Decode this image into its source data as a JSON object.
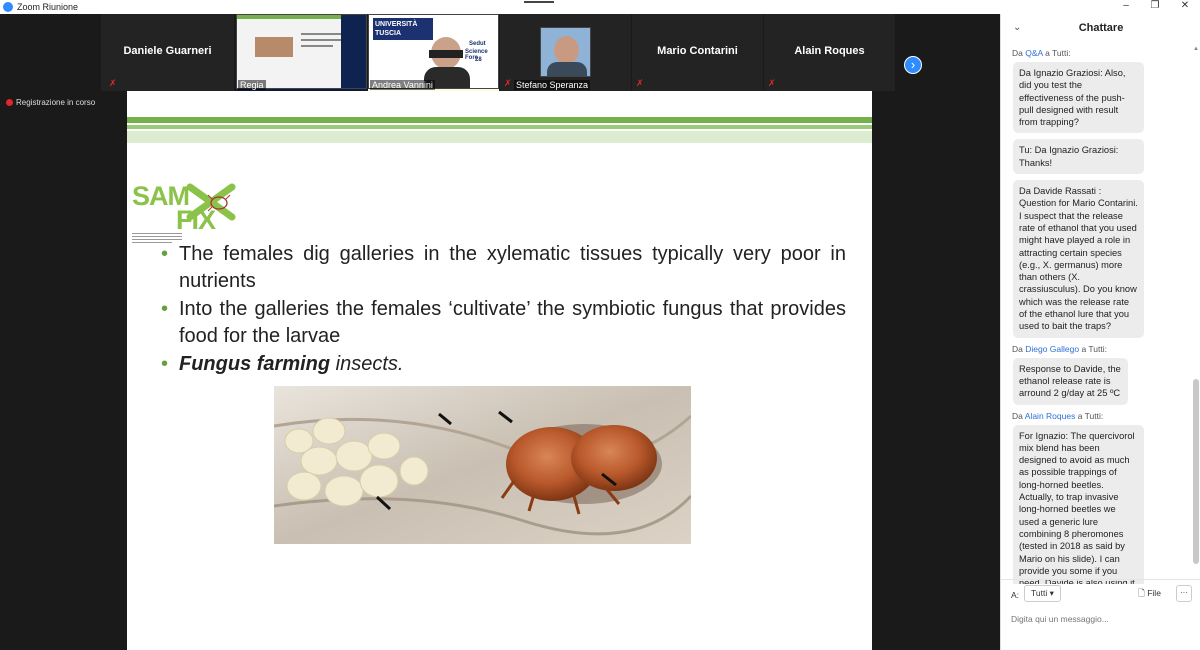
{
  "window": {
    "title": "Zoom Riunione"
  },
  "gallery": {
    "participants": [
      {
        "name": "Daniele Guarneri"
      },
      {
        "name": "Regia"
      },
      {
        "name": "Andrea Vannini"
      },
      {
        "name": "Stefano Speranza"
      },
      {
        "name": "Mario Contarini"
      },
      {
        "name": "Alain Roques"
      }
    ],
    "mini_slide_university": "UNIVERSITÀ TUSCIA",
    "mini_slide_lines": [
      "Sedut",
      "Science Fore",
      "28"
    ]
  },
  "recording": {
    "label": "Registrazione in corso"
  },
  "slide": {
    "logo_text": [
      "SAM",
      "FIX"
    ],
    "bullets": [
      "The females dig galleries in the xylematic tissues typically very poor in nutrients",
      "Into the galleries the females ‘cultivate’ the symbiotic fungus that provides food for the larvae"
    ],
    "bullet3_bold": "Fungus farming",
    "bullet3_rest": " insects."
  },
  "chat": {
    "title": "Chattare",
    "messages": [
      {
        "prefix": "Da ",
        "sender": "Q&A",
        "suffix": " a Tutti:",
        "text": "Da Ignazio Graziosi: Also, did you test the effectiveness of the push-pull designed with result from trapping?"
      },
      {
        "prefix": "",
        "sender": "",
        "suffix": "",
        "text": "Tu: Da Ignazio Graziosi: Thanks!"
      },
      {
        "prefix": "",
        "sender": "",
        "suffix": "",
        "text": "Da Davide Rassati : Question for Mario Contarini. I suspect that the release rate of ethanol that you used might have played a role in attracting certain species (e.g., X. germanus) more than others (X. crassiusculus). Do you know which was the release rate of the ethanol lure that you used to bait the traps?"
      },
      {
        "prefix": "Da ",
        "sender": "Diego Gallego",
        "suffix": " a Tutti:",
        "text": "Response to Davide, the ethanol release rate is arround 2 g/day at 25 ºC"
      },
      {
        "prefix": "Da ",
        "sender": "Alain Roques",
        "suffix": " a Tutti:",
        "text": "For Ignazio: The quercivorol mix blend has been designed to avoid as much as possible trappings of long-horned beetles. Actually, to trap invasive long-horned beetles we used a generic lure combining 8 pheromones (tested in 2018 as said by Mario on his slide). I can provide you some if you need. Davide is also using it."
      }
    ],
    "to_label": "A:",
    "to_value": "Tutti",
    "file_label": "File",
    "more_label": "···",
    "input_placeholder": "Digita qui un messaggio..."
  },
  "colors": {
    "accent": "#2d8cff",
    "slide_green": "#74b14c",
    "record_red": "#e02828"
  }
}
